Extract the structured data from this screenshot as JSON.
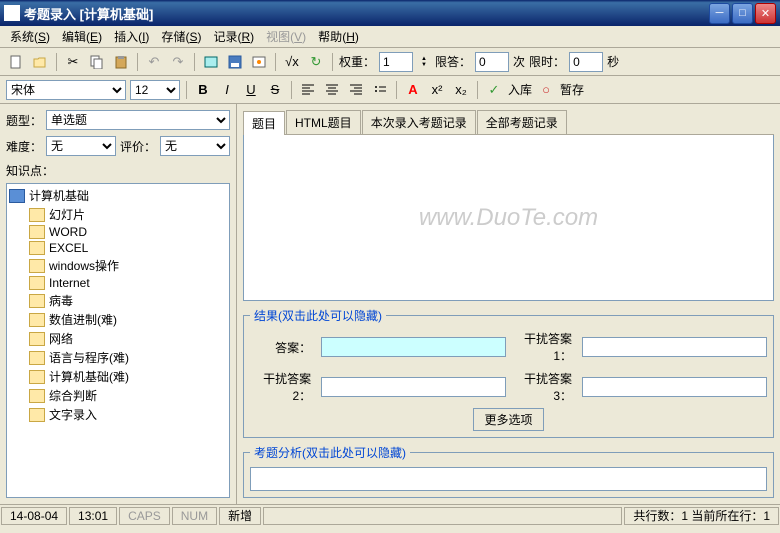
{
  "title": "考题录入 [计算机基础]",
  "menu": {
    "system": "系统",
    "sys_k": "S",
    "edit": "编辑",
    "edit_k": "E",
    "insert": "插入",
    "ins_k": "I",
    "save": "存储",
    "save_k": "S",
    "record": "记录",
    "rec_k": "R",
    "view": "视图",
    "view_k": "V",
    "help": "帮助",
    "help_k": "H"
  },
  "tb": {
    "weight": "权重：",
    "weight_v": "1",
    "ans_count": "限答：",
    "ans_v": "0",
    "times": "次",
    "limit": "限时：",
    "limit_v": "0",
    "sec": "秒",
    "store": "入库",
    "temp": "暂存"
  },
  "font_name": "宋体",
  "font_size": "12",
  "left": {
    "type_lbl": "题型：",
    "type_v": "单选题",
    "diff_lbl": "难度：",
    "diff_v": "无",
    "rate_lbl": "评价：",
    "rate_v": "无",
    "tree_lbl": "知识点："
  },
  "tree": {
    "root": "计算机基础",
    "items": [
      "幻灯片",
      "WORD",
      "EXCEL",
      "windows操作",
      "Internet",
      "病毒",
      "数值进制(难)",
      "网络",
      "语言与程序(难)",
      "计算机基础(难)",
      "综合判断",
      "文字录入"
    ]
  },
  "tabs": {
    "t1": "题目",
    "t2": "HTML题目",
    "t3": "本次录入考题记录",
    "t4": "全部考题记录"
  },
  "watermark": "www.DuoTe.com",
  "result": {
    "legend": "结果(双击此处可以隐藏)",
    "ans": "答案：",
    "d1": "干扰答案1：",
    "d2": "干扰答案2：",
    "d3": "干扰答案3：",
    "more": "更多选项"
  },
  "analysis": {
    "legend": "考题分析(双击此处可以隐藏)"
  },
  "status": {
    "date": "14-08-04",
    "time": "13:01",
    "caps": "CAPS",
    "num": "NUM",
    "new": "新增",
    "rows": "共行数：1 当前所在行：1"
  }
}
